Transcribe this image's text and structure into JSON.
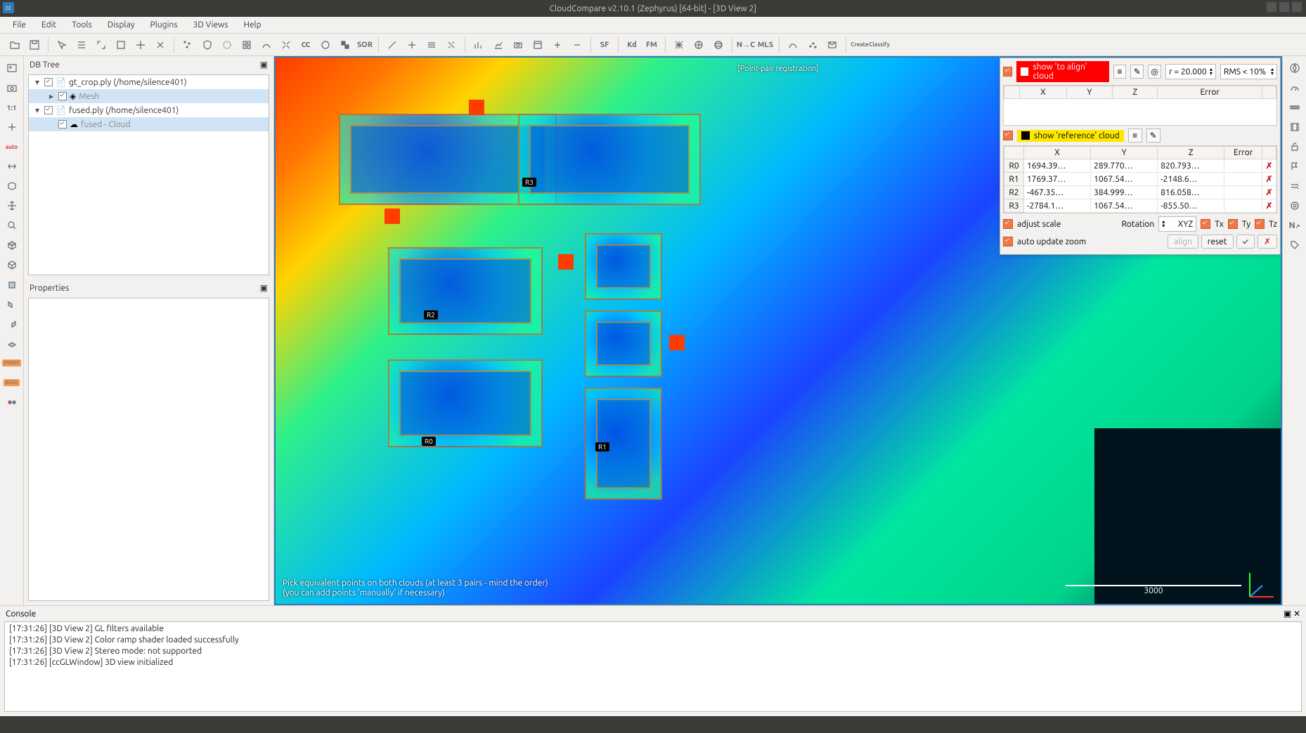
{
  "app": {
    "title": "CloudCompare v2.10.1 (Zephyrus) [64-bit] - [3D View 2]"
  },
  "menu": [
    "File",
    "Edit",
    "Tools",
    "Display",
    "Plugins",
    "3D Views",
    "Help"
  ],
  "left_toolbar_icons": [
    "view-image",
    "camera",
    "one-to-one",
    "plus",
    "auto",
    "arrows",
    "box",
    "move",
    "zoom",
    "cube-front",
    "cube-iso",
    "cube-front2",
    "cube-right",
    "cube-left",
    "cube-bottom",
    "front-label",
    "back-label",
    "two-dots"
  ],
  "right_toolbar_icons": [
    "compass",
    "odometer",
    "ruler",
    "film",
    "lock-open",
    "flag",
    "waves",
    "target",
    "nav-n",
    "tag"
  ],
  "toolbar_labels": {
    "sor": "SOR",
    "sf": "SF",
    "kd": "Kd",
    "fm": "FM",
    "nc": "N→C",
    "mls": "MLS",
    "create": "Create",
    "classify": "Classify"
  },
  "db_tree": {
    "title": "DB Tree",
    "items": [
      {
        "expanded": true,
        "checked": true,
        "icon": "file",
        "label": "gt_crop.ply (/home/silence401)",
        "depth": 0
      },
      {
        "expanded": false,
        "checked": true,
        "icon": "mesh",
        "label": "Mesh",
        "depth": 1,
        "selected": true
      },
      {
        "expanded": true,
        "checked": true,
        "icon": "file",
        "label": "fused.ply (/home/silence401)",
        "depth": 0
      },
      {
        "expanded": null,
        "checked": true,
        "icon": "cloud",
        "label": "fused - Cloud",
        "depth": 1,
        "selected": true
      }
    ]
  },
  "properties": {
    "title": "Properties"
  },
  "view": {
    "mode_label": "[Point-pair registration]",
    "hint1": "Pick equivalent points on both clouds (at least 3 pairs - mind the order)",
    "hint2": "(you can add points 'manually' if necessary)",
    "scale_value": "3000",
    "points": [
      {
        "id": "R0",
        "x": "605",
        "y": "610"
      },
      {
        "id": "R1",
        "x": "852",
        "y": "618"
      },
      {
        "id": "R2",
        "x": "608",
        "y": "430"
      },
      {
        "id": "R3",
        "x": "748",
        "y": "241"
      }
    ]
  },
  "reg_panel": {
    "align_label": "show 'to align' cloud",
    "ref_label": "show 'reference' cloud",
    "r_value": "r = 20.000",
    "rms_value": "RMS < 10%",
    "align_headers": [
      "X",
      "Y",
      "Z",
      "Error"
    ],
    "ref_headers": [
      "X",
      "Y",
      "Z",
      "Error"
    ],
    "ref_rows": [
      {
        "id": "R0",
        "x": "1694.39…",
        "y": "289.770…",
        "z": "820.793…",
        "err": ""
      },
      {
        "id": "R1",
        "x": "1769.37…",
        "y": "1067.54…",
        "z": "-2148.6…",
        "err": ""
      },
      {
        "id": "R2",
        "x": "-467.35…",
        "y": "384.999…",
        "z": "816.058…",
        "err": ""
      },
      {
        "id": "R3",
        "x": "-2784.1…",
        "y": "1067.54…",
        "z": "-855.50…",
        "err": ""
      }
    ],
    "adjust_scale": "adjust scale",
    "rotation_label": "Rotation",
    "rotation_value": "XYZ",
    "tx": "Tx",
    "ty": "Ty",
    "tz": "Tz",
    "auto_zoom": "auto update zoom",
    "align_btn": "align",
    "reset_btn": "reset"
  },
  "console": {
    "title": "Console",
    "lines": [
      "[17:31:26] [3D View 2] GL filters available",
      "[17:31:26] [3D View 2] Color ramp shader loaded successfully",
      "[17:31:26] [3D View 2] Stereo mode: not supported",
      "[17:31:26] [ccGLWindow] 3D view initialized"
    ]
  }
}
